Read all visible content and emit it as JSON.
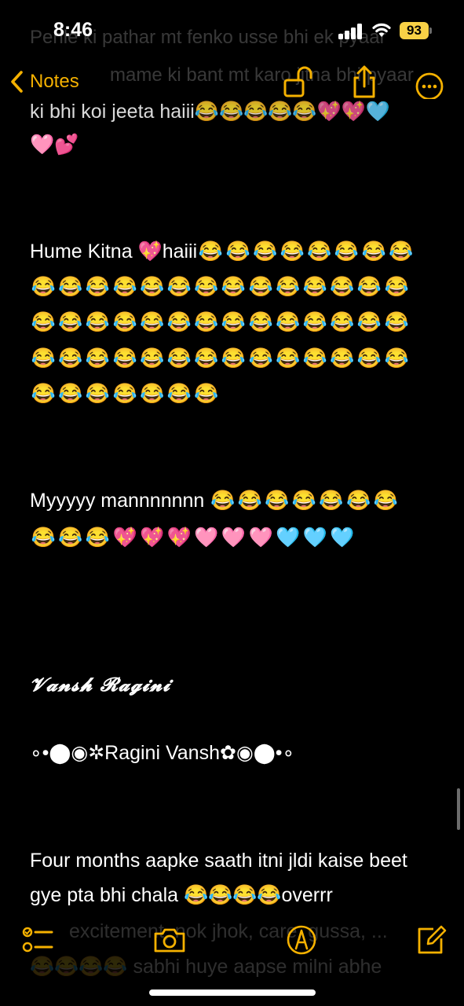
{
  "status": {
    "time": "8:46",
    "battery": "93"
  },
  "nav": {
    "back_label": "Notes"
  },
  "ghost": {
    "line1": "Pehle ki pathar mt fenko usse bhi ek pyaar",
    "line2": "mame ki bant mt karo jitna bhi pyaar"
  },
  "note": {
    "line_top": "ki bhi koi jeeta haiii",
    "line_top_emojis": "😂😂😂😂😂💖💖🩵",
    "line_top2": "🩷💕",
    "para1_text": "Hume Kitna 💖haiii",
    "para1_row1": [
      "😂",
      "😂",
      "😂",
      "😂",
      "😂",
      "😂",
      "😂",
      "😂"
    ],
    "para1_row2": [
      "😂",
      "😂",
      "😂",
      "😂",
      "😂",
      "😂",
      "😂",
      "😂",
      "😂",
      "😂",
      "😂",
      "😂",
      "😂",
      "😂"
    ],
    "para1_row3": [
      "😂",
      "😂",
      "😂",
      "😂",
      "😂",
      "😂",
      "😂",
      "😂",
      "😂",
      "😂",
      "😂",
      "😂",
      "😂",
      "😂"
    ],
    "para1_row4": [
      "😂",
      "😂",
      "😂",
      "😂",
      "😂",
      "😂",
      "😂",
      "😂",
      "😂",
      "😂",
      "😂",
      "😂",
      "😂",
      "😂"
    ],
    "para1_row5": [
      "😂",
      "😂",
      "😂",
      "😂",
      "😂",
      "😂",
      "😂"
    ],
    "para2_text": "Myyyyy mannnnnnn",
    "para2_row1": [
      "😂",
      "😂",
      "😂",
      "😂",
      "😂",
      "😂",
      "😂"
    ],
    "para2_row2": [
      "😂",
      "😂",
      "😂",
      "💖",
      "💖",
      "💖",
      "🩷",
      "🩷",
      "🩷",
      "🩵",
      "🩵",
      "🩵"
    ],
    "script_name": "𝓥𝓪𝓷𝓼𝓱 𝓡𝓪𝓰𝓲𝓷𝓲",
    "deco_name": "∘•⬤◉✲Ragini Vansh✿◉⬤•∘",
    "para3_line1": "Four months aapke saath  itni jldi kaise beet",
    "para3_line2": "gye pta bhi chala 😂😂😂😂overrr",
    "para3_line3": "excitement, nok jhok, care, gussa, ...",
    "para3_line4": "😂😂😂😂 sabhi huye aapse milni abhe"
  },
  "colors": {
    "accent": "#f5b100",
    "background": "#000000",
    "text": "#ffffff"
  },
  "icons": [
    "chevron-left-icon",
    "unlock-icon",
    "share-icon",
    "more-icon",
    "checklist-icon",
    "camera-icon",
    "markup-icon",
    "compose-icon"
  ]
}
